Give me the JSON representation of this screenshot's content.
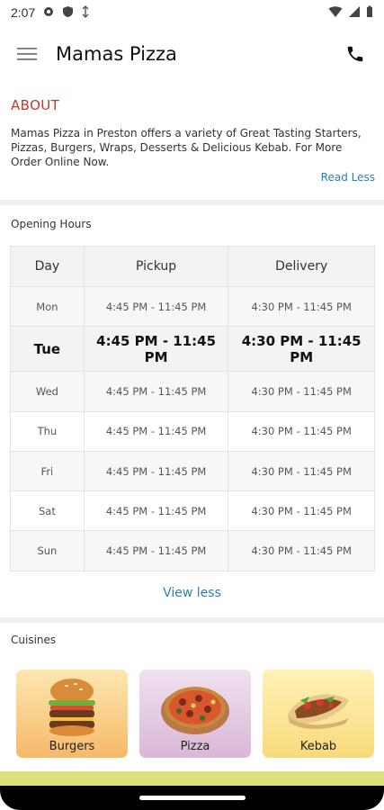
{
  "status_bar": {
    "time": "2:07"
  },
  "app_bar": {
    "title": "Mamas Pizza",
    "menu_icon": "hamburger-menu-icon",
    "call_icon": "phone-icon"
  },
  "about": {
    "title": "ABOUT",
    "text": "Mamas Pizza in Preston offers a variety of Great Tasting Starters, Pizzas, Burgers, Wraps, Desserts & Delicious Kebab. For More Order Online Now.",
    "read_less": "Read Less"
  },
  "hours": {
    "label": "Opening Hours",
    "headers": {
      "day": "Day",
      "pickup": "Pickup",
      "delivery": "Delivery"
    },
    "today": "Tue",
    "rows": [
      {
        "day": "Mon",
        "pickup": "4:45 PM - 11:45 PM",
        "delivery": "4:30 PM - 11:45 PM"
      },
      {
        "day": "Tue",
        "pickup": "4:45 PM - 11:45 PM",
        "delivery": "4:30 PM - 11:45 PM"
      },
      {
        "day": "Wed",
        "pickup": "4:45 PM - 11:45 PM",
        "delivery": "4:30 PM - 11:45 PM"
      },
      {
        "day": "Thu",
        "pickup": "4:45 PM - 11:45 PM",
        "delivery": "4:30 PM - 11:45 PM"
      },
      {
        "day": "Fri",
        "pickup": "4:45 PM - 11:45 PM",
        "delivery": "4:30 PM - 11:45 PM"
      },
      {
        "day": "Sat",
        "pickup": "4:45 PM - 11:45 PM",
        "delivery": "4:30 PM - 11:45 PM"
      },
      {
        "day": "Sun",
        "pickup": "4:45 PM - 11:45 PM",
        "delivery": "4:30 PM - 11:45 PM"
      }
    ],
    "view_less": "View less"
  },
  "cuisines": {
    "label": "Cuisines",
    "items": [
      {
        "name": "Burgers",
        "icon": "burger-icon"
      },
      {
        "name": "Pizza",
        "icon": "pizza-icon"
      },
      {
        "name": "Kebab",
        "icon": "kebab-icon"
      }
    ]
  },
  "colors": {
    "accent_red": "#c0392b",
    "link_blue": "#2a7fba"
  }
}
